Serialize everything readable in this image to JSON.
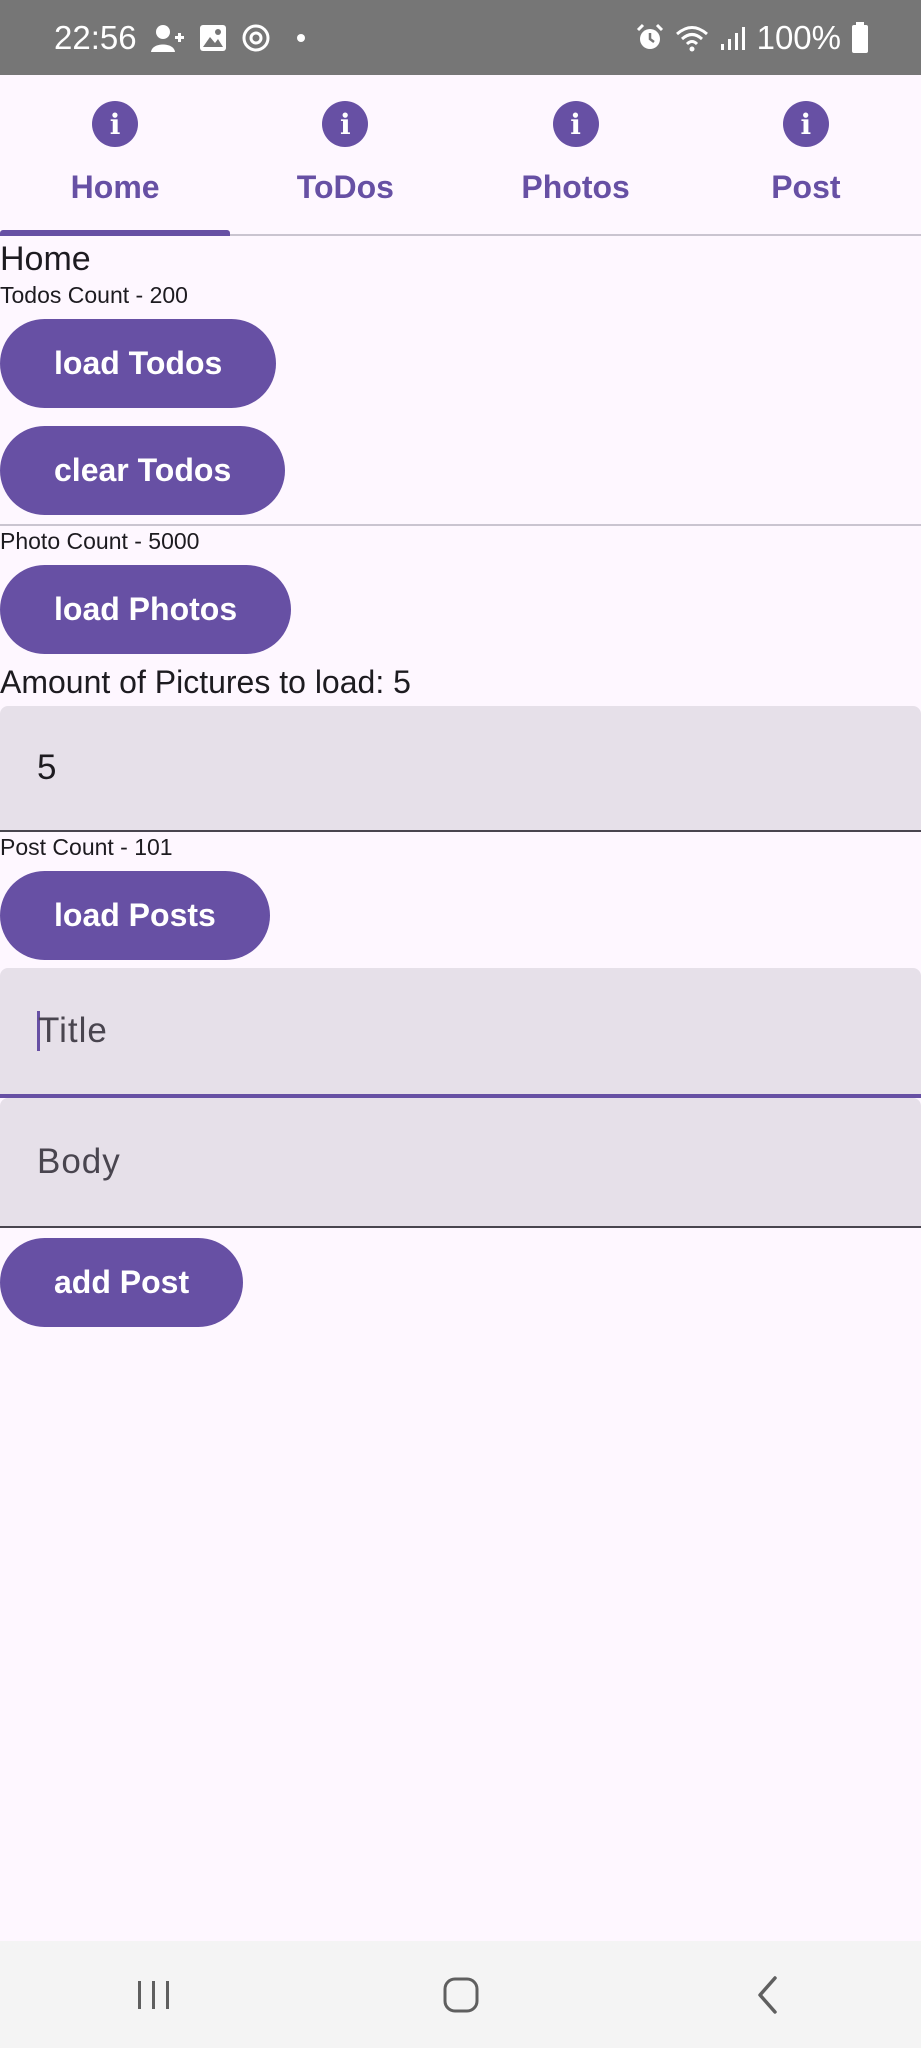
{
  "status_bar": {
    "time": "22:56",
    "battery": "100%",
    "icons": [
      "person-add-icon",
      "image-icon",
      "sync-icon",
      "alarm-icon",
      "wifi-icon",
      "signal-icon",
      "battery-icon"
    ]
  },
  "tabs": [
    {
      "label": "Home",
      "icon": "info-icon",
      "selected": true
    },
    {
      "label": "ToDos",
      "icon": "info-icon",
      "selected": false
    },
    {
      "label": "Photos",
      "icon": "info-icon",
      "selected": false
    },
    {
      "label": "Post",
      "icon": "info-icon",
      "selected": false
    }
  ],
  "home": {
    "title": "Home",
    "todos": {
      "count_text": "Todos Count - 200",
      "load_label": "load Todos",
      "clear_label": "clear Todos"
    },
    "photos": {
      "count_text": "Photo Count - 5000",
      "load_label": "load Photos",
      "amount_text": "Amount of Pictures to load: 5",
      "amount_value": "5"
    },
    "posts": {
      "count_text": "Post Count - 101",
      "load_label": "load Posts",
      "title_placeholder": "Title",
      "body_placeholder": "Body",
      "add_label": "add Post"
    }
  },
  "colors": {
    "primary": "#6750a4",
    "background": "#fef7ff",
    "field_background": "#e6e0e9",
    "status_bar": "#767676"
  }
}
